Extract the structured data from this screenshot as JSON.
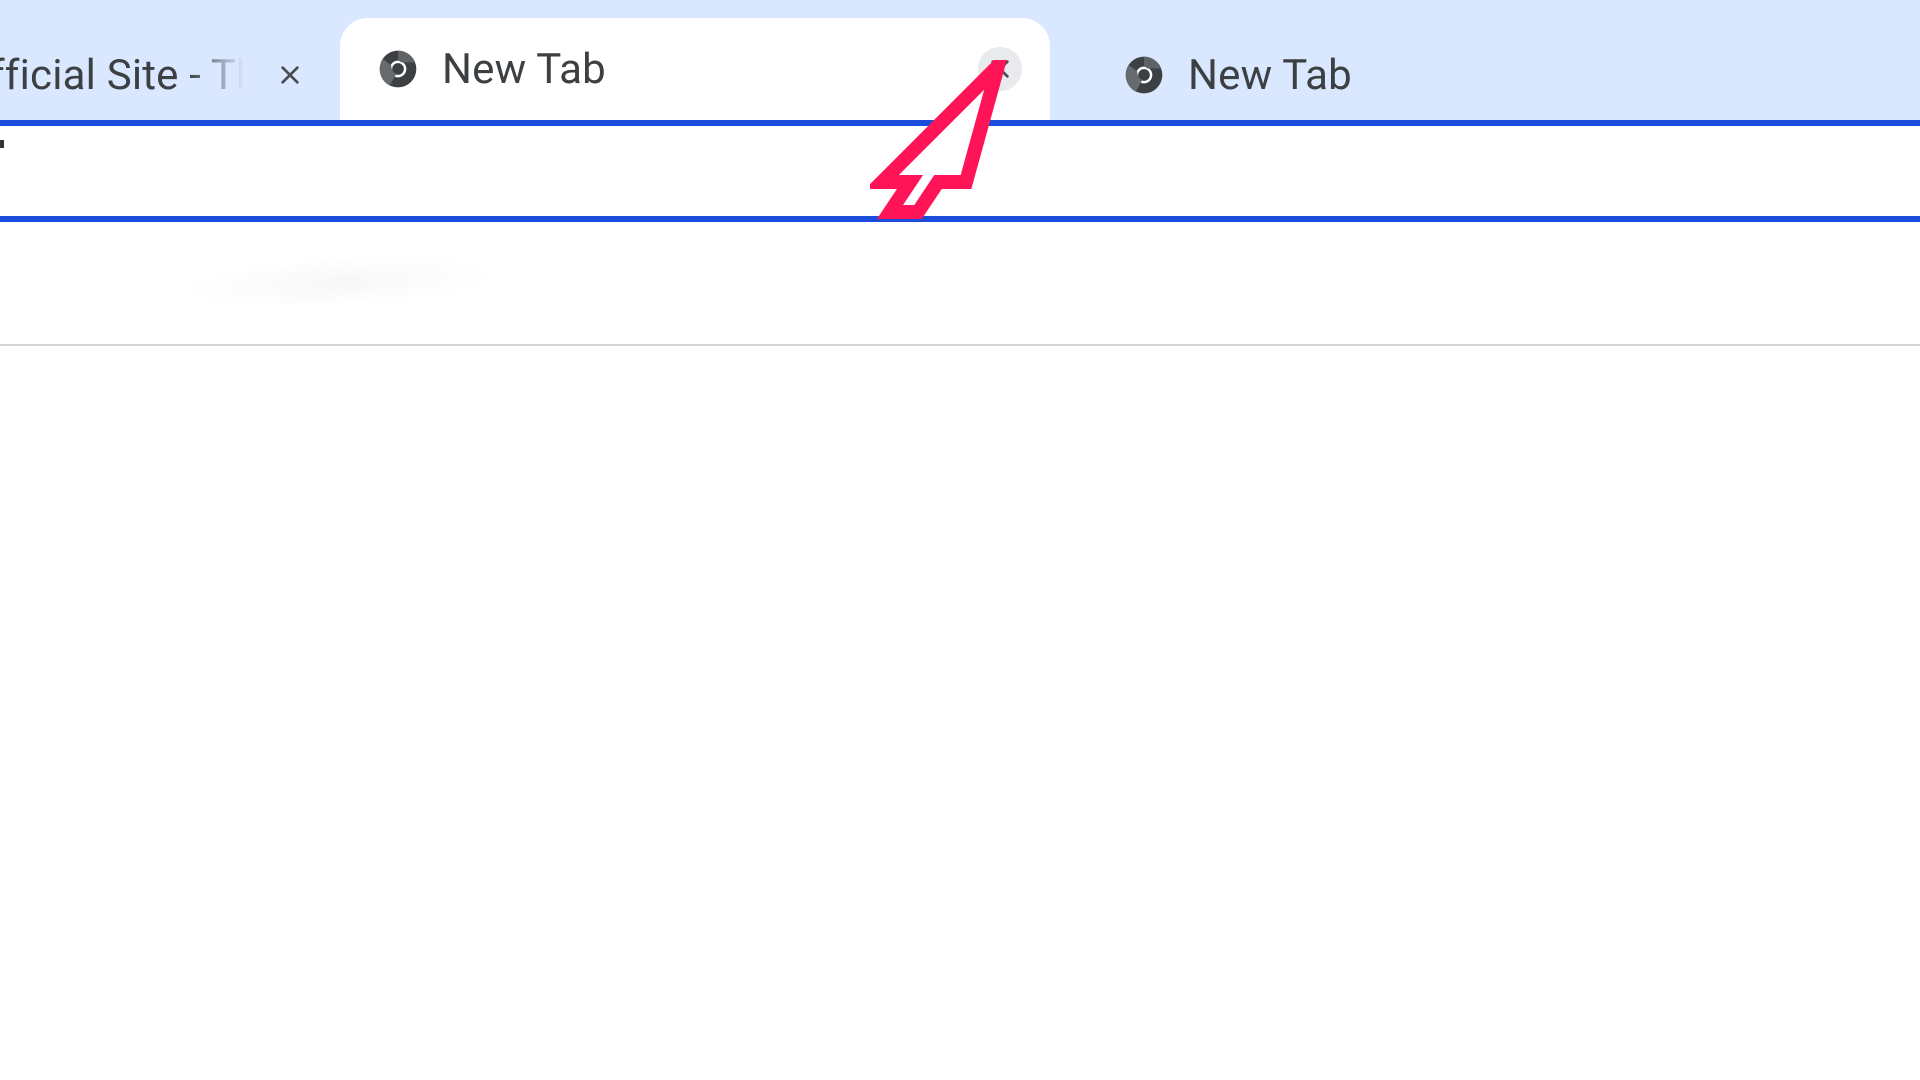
{
  "tabstrip": {
    "tabs": [
      {
        "title": "fficial Site - The",
        "active": false
      },
      {
        "title": "New Tab",
        "active": true
      },
      {
        "title": "New Tab",
        "active": false
      }
    ]
  },
  "annotation": {
    "color": "#ff1457",
    "target": "close button of the active tab"
  }
}
